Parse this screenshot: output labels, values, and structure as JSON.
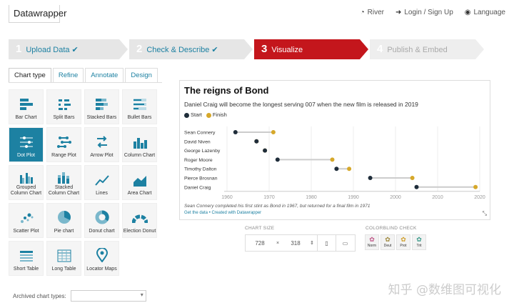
{
  "header": {
    "logo": "Datawrapper",
    "nav": [
      {
        "icon": "palette-icon",
        "label": "River"
      },
      {
        "icon": "sign-in-icon",
        "label": "Login / Sign Up"
      },
      {
        "icon": "globe-icon",
        "label": "Language"
      }
    ]
  },
  "steps": [
    {
      "num": "1",
      "label": "Upload Data ✔",
      "state": "done"
    },
    {
      "num": "2",
      "label": "Check & Describe ✔",
      "state": "done"
    },
    {
      "num": "3",
      "label": "Visualize",
      "state": "active"
    },
    {
      "num": "4",
      "label": "Publish & Embed",
      "state": "todo"
    }
  ],
  "tabs": [
    "Chart type",
    "Refine",
    "Annotate",
    "Design"
  ],
  "chart_types": [
    {
      "label": "Bar Chart",
      "icon": "bar-chart-icon"
    },
    {
      "label": "Split Bars",
      "icon": "split-bars-icon"
    },
    {
      "label": "Stacked Bars",
      "icon": "stacked-bars-icon"
    },
    {
      "label": "Bullet Bars",
      "icon": "bullet-bars-icon"
    },
    {
      "label": "Dot Plot",
      "icon": "dot-plot-icon",
      "active": true
    },
    {
      "label": "Range Plot",
      "icon": "range-plot-icon"
    },
    {
      "label": "Arrow Plot",
      "icon": "arrow-plot-icon"
    },
    {
      "label": "Column Chart",
      "icon": "column-chart-icon"
    },
    {
      "label": "Grouped Column Chart",
      "icon": "grouped-column-icon"
    },
    {
      "label": "Stacked Column Chart",
      "icon": "stacked-column-icon"
    },
    {
      "label": "Lines",
      "icon": "line-chart-icon"
    },
    {
      "label": "Area Chart",
      "icon": "area-chart-icon"
    },
    {
      "label": "Scatter Plot",
      "icon": "scatter-plot-icon"
    },
    {
      "label": "Pie chart",
      "icon": "pie-chart-icon"
    },
    {
      "label": "Donut chart",
      "icon": "donut-chart-icon"
    },
    {
      "label": "Election Donut",
      "icon": "election-donut-icon"
    },
    {
      "label": "Short Table",
      "icon": "short-table-icon"
    },
    {
      "label": "Long Table",
      "icon": "long-table-icon"
    },
    {
      "label": "Locator Maps",
      "icon": "map-pin-icon"
    }
  ],
  "archived_label": "Archived chart types:",
  "preview": {
    "title": "The reigns of Bond",
    "subtitle": "Daniel Craig will become the longest serving 007 when the new film is released in 2019",
    "legend_start": "Start",
    "legend_finish": "Finish",
    "note": "Sean Connery completed his first stint as Bond in 1967, but returned for a final film in 1971",
    "source": "Get the data • Created with Datawrapper"
  },
  "colors": {
    "start": "#1f2d3a",
    "finish": "#d6a82a",
    "range": "#cccccc",
    "accent": "#1d81a2",
    "active_step": "#c4161c"
  },
  "chart_data": {
    "type": "dot-range",
    "series": [
      {
        "name": "Start"
      },
      {
        "name": "Finish"
      }
    ],
    "categories": [
      "Sean Connery",
      "David Niven",
      "George Lazenby",
      "Roger Moore",
      "Timothy Dalton",
      "Pierce Brosnan",
      "Daniel Craig"
    ],
    "start": [
      1962,
      1967,
      1969,
      1972,
      1986,
      1994,
      2005
    ],
    "finish": [
      1971,
      1967,
      1969,
      1985,
      1989,
      2004,
      2019
    ],
    "xticks": [
      1960,
      1970,
      1980,
      1990,
      2000,
      2010,
      2020
    ],
    "xlim": [
      1960,
      2020
    ]
  },
  "chart_size": {
    "label": "CHART SIZE",
    "width": "728",
    "x": "×",
    "height": "318"
  },
  "colorblind": {
    "label": "COLORBLIND CHECK",
    "modes": [
      "Norm",
      "Deut",
      "Prot",
      "Trit"
    ]
  },
  "watermark": "知乎 @数维图可视化"
}
